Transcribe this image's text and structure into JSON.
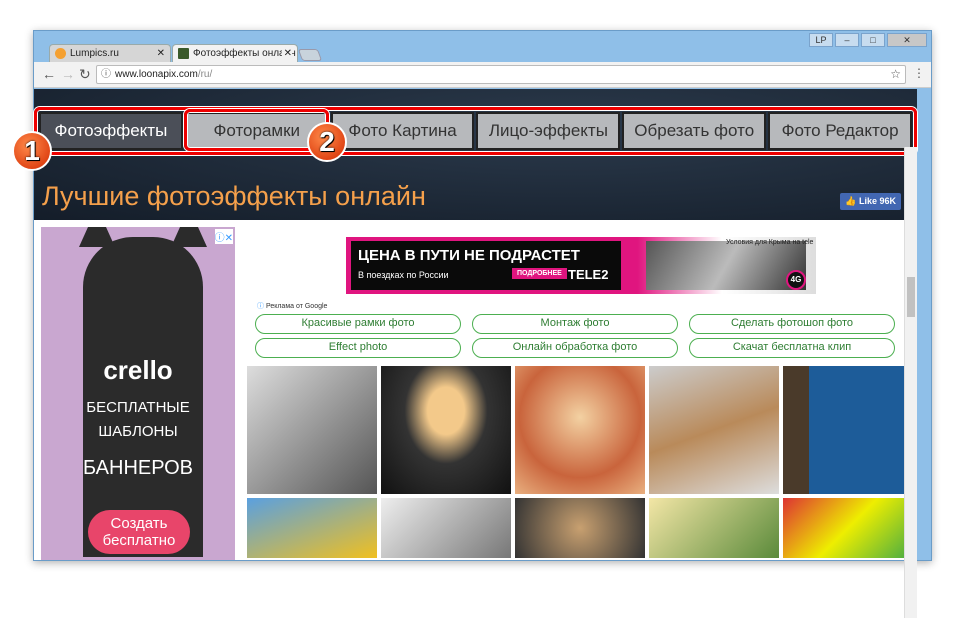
{
  "browser": {
    "tabs": [
      {
        "title": "Lumpics.ru",
        "favicon_color": "#f5a030"
      },
      {
        "title": "Фотоэффекты онлайн бе",
        "favicon_color": "#3a5a2a"
      }
    ],
    "window_user": "LP",
    "url_host": "www.loonapix.com",
    "url_path": "/ru/",
    "icons": [
      "back-icon",
      "forward-icon",
      "reload-icon",
      "info-icon",
      "star-icon",
      "menu-icon"
    ]
  },
  "nav": {
    "items": [
      "Фотоэффекты",
      "Фоторамки",
      "Фото Картина",
      "Лицо-эффекты",
      "Обрезать фото",
      "Фото Редактор"
    ],
    "active": 0
  },
  "annotations": {
    "badge1": "1",
    "badge2": "2",
    "highlight_color": "#e00000"
  },
  "page": {
    "title": "Лучшие фотоэффекты онлайн",
    "like": "Like 96K"
  },
  "ad_left": {
    "brand": "crello",
    "line1": "БЕСПЛАТНЫЕ",
    "line2": "ШАБЛОНЫ",
    "line3": "БАННЕРОВ",
    "cta": "Создать бесплатно"
  },
  "banner": {
    "headline": "ЦЕНА В ПУТИ НЕ ПОДРАСТЕТ",
    "sub": "В поездках по России",
    "button": "ПОДРОБНЕЕ",
    "brand": "TELE2",
    "conditions": "Условия для Крыма на tele",
    "badge": "4G"
  },
  "ad_label": "Реклама от Google",
  "links": [
    "Красивые рамки фото",
    "Монтаж фото",
    "Сделать фотошоп фото",
    "Effect photo",
    "Онлайн обработка фото",
    "Скачат бесплатна клип"
  ],
  "colors": {
    "accent_title": "#f5a04b",
    "link_border": "#4caf50",
    "nav_active": "#4b4f58"
  }
}
